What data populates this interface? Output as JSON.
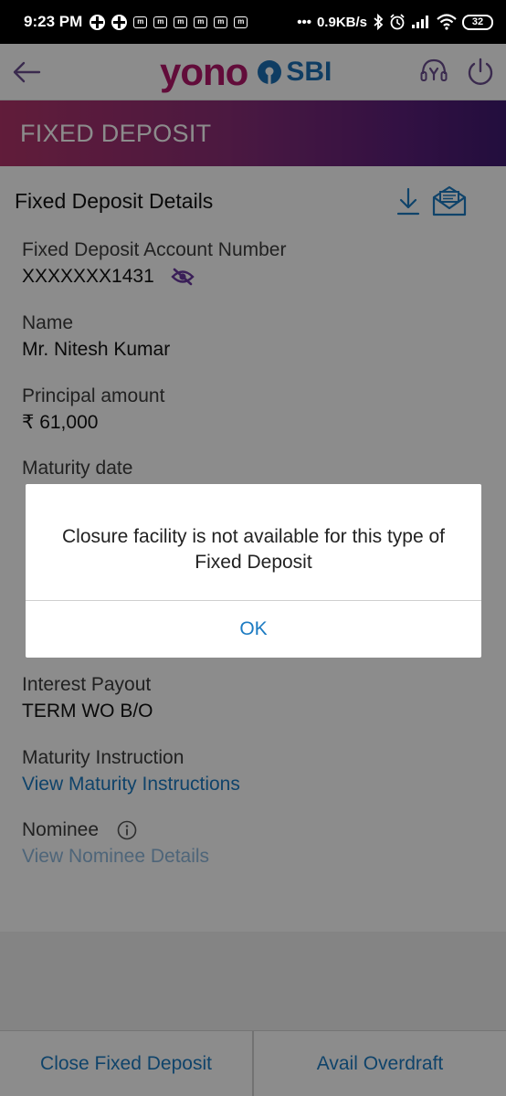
{
  "status_bar": {
    "time": "9:23 PM",
    "notification_glyph": "m",
    "network_speed": "0.9KB/s",
    "battery": "32"
  },
  "header": {
    "brand_left": "yono",
    "brand_right": "SBI",
    "icons": [
      "back-arrow-icon",
      "sbi-logo-icon",
      "help-headset-icon",
      "power-icon"
    ],
    "brand_color": "#b3176b",
    "sbi_color": "#1c6fb5"
  },
  "page": {
    "title": "FIXED DEPOSIT"
  },
  "details": {
    "section_title": "Fixed Deposit Details",
    "account_label": "Fixed Deposit Account Number",
    "account_value": "XXXXXXX1431",
    "name_label": "Name",
    "name_value": "Mr. Nitesh Kumar",
    "principal_label": "Principal amount",
    "principal_value": "₹ 61,000",
    "maturity_date_label": "Maturity date",
    "interest_payout_label": "Interest Payout",
    "interest_payout_value": "TERM WO B/O",
    "maturity_instruction_label": "Maturity Instruction",
    "maturity_instruction_link": "View Maturity Instructions",
    "nominee_label": "Nominee",
    "nominee_link": "View Nominee Details"
  },
  "bottom_bar": {
    "close_label": "Close Fixed Deposit",
    "overdraft_label": "Avail Overdraft"
  },
  "dialog": {
    "message_line1": "Closure facility is not available for this type of",
    "message_line2": "Fixed Deposit",
    "ok_label": "OK"
  },
  "colors": {
    "accent_link": "#1c7bc2",
    "title_band_start": "#b1346a",
    "title_band_end": "#3f1a70"
  }
}
